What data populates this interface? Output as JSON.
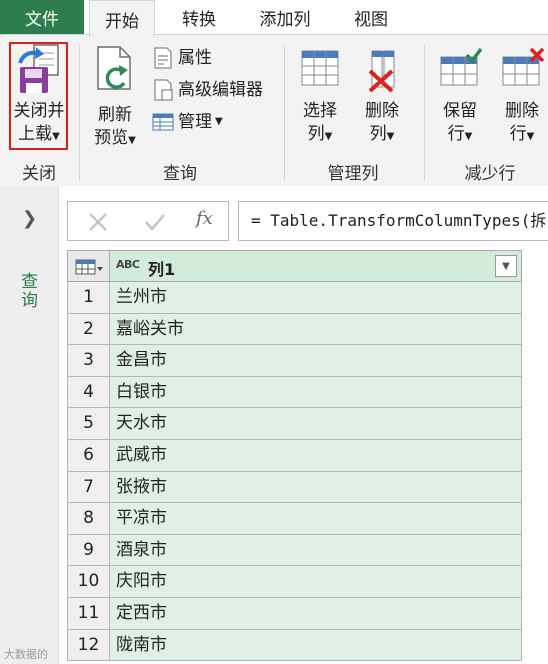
{
  "tabs": {
    "file": "文件",
    "home": "开始",
    "transform": "转换",
    "add_column": "添加列",
    "view": "视图"
  },
  "ribbon": {
    "close_load": {
      "line1": "关闭并",
      "line2": "上载"
    },
    "refresh_preview": {
      "line1": "刷新",
      "line2": "预览"
    },
    "properties": "属性",
    "advanced_editor": "高级编辑器",
    "manage": "管理",
    "choose_columns": {
      "line1": "选择",
      "line2": "列"
    },
    "remove_columns": {
      "line1": "删除",
      "line2": "列"
    },
    "keep_rows": {
      "line1": "保留",
      "line2": "行"
    },
    "remove_rows": {
      "line1": "删除",
      "line2": "行"
    },
    "groups": {
      "close": "关闭",
      "query": "查询",
      "manage_columns": "管理列",
      "reduce_rows": "减少行"
    }
  },
  "query_pane": {
    "label": "查询"
  },
  "formula_bar": {
    "fx": "fx",
    "formula": "= Table.TransformColumnTypes(拆"
  },
  "grid": {
    "type_icon": "ABC",
    "column_header": "列1",
    "rows": [
      {
        "n": "1",
        "v": "兰州市"
      },
      {
        "n": "2",
        "v": "嘉峪关市"
      },
      {
        "n": "3",
        "v": "金昌市"
      },
      {
        "n": "4",
        "v": "白银市"
      },
      {
        "n": "5",
        "v": "天水市"
      },
      {
        "n": "6",
        "v": "武威市"
      },
      {
        "n": "7",
        "v": "张掖市"
      },
      {
        "n": "8",
        "v": "平凉市"
      },
      {
        "n": "9",
        "v": "酒泉市"
      },
      {
        "n": "10",
        "v": "庆阳市"
      },
      {
        "n": "11",
        "v": "定西市"
      },
      {
        "n": "12",
        "v": "陇南市"
      }
    ]
  },
  "watermark": "大数据的",
  "colors": {
    "accent": "#2e7d4f",
    "highlight": "#d9231f",
    "cell_bg": "#dff1e4"
  }
}
